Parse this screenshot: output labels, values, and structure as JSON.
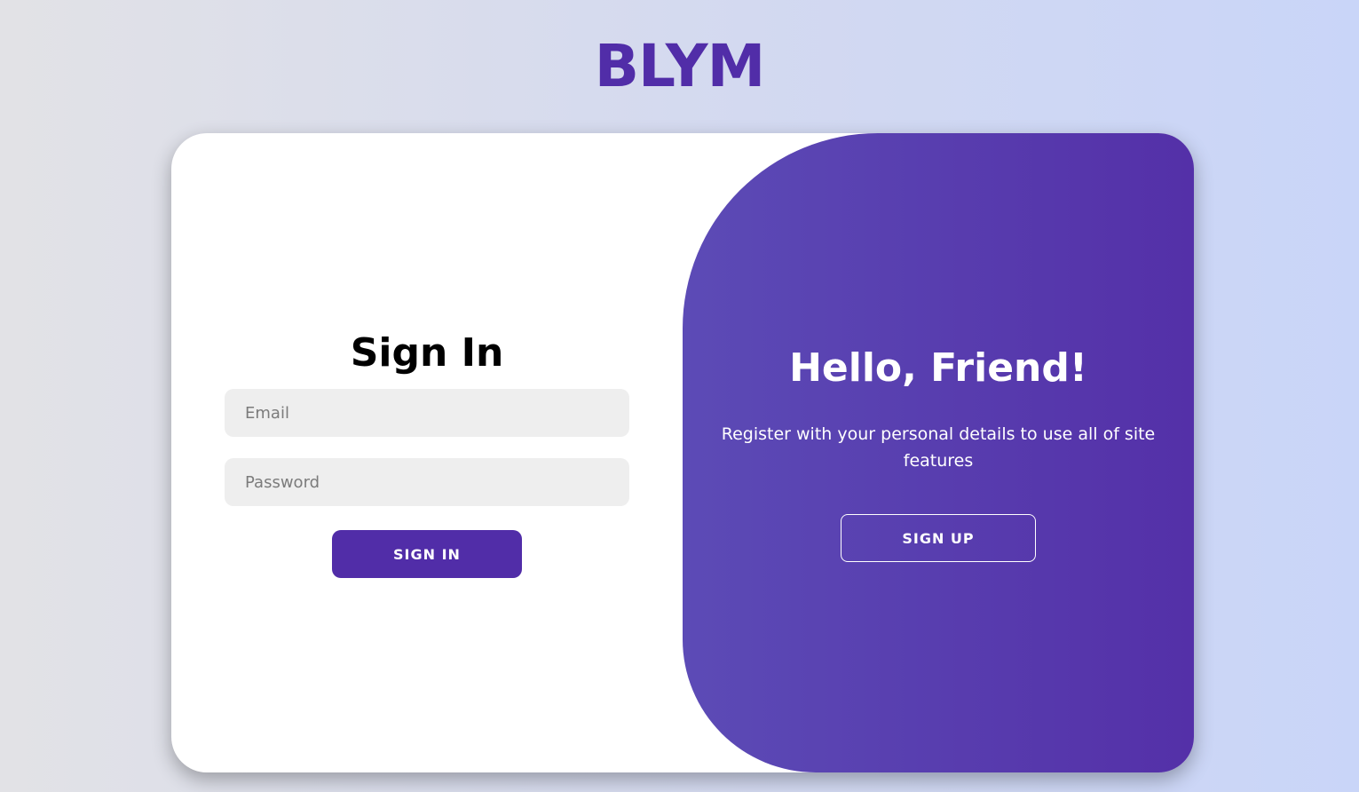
{
  "brand": {
    "logo_text": "BLYM",
    "color": "#512da8"
  },
  "signin": {
    "title": "Sign In",
    "email_placeholder": "Email",
    "password_placeholder": "Password",
    "submit_label": "SIGN IN"
  },
  "toggle": {
    "title": "Hello, Friend!",
    "text": "Register with your personal details to use all of site features",
    "signup_label": "SIGN UP"
  },
  "colors": {
    "accent": "#512da8",
    "input_bg": "#eeeeee",
    "panel_gradient_start": "#5c4bb6",
    "panel_gradient_end": "#5430a8",
    "page_bg_start": "#e2e2e6",
    "page_bg_end": "#c9d5f8"
  }
}
